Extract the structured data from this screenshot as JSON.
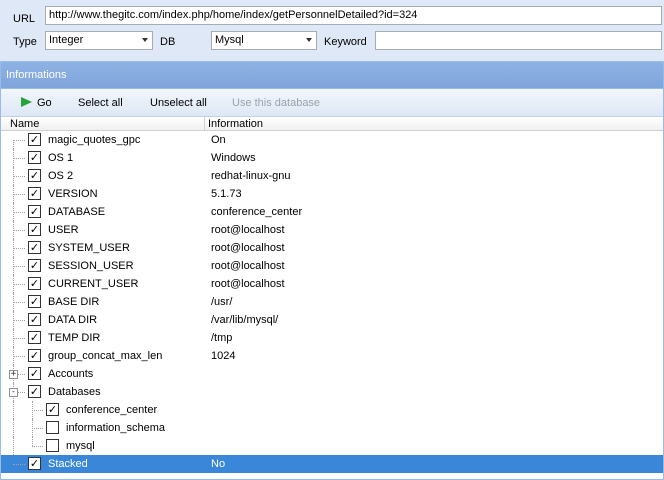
{
  "form": {
    "url_label": "URL",
    "url_value": "http://www.thegitc.com/index.php/home/index/getPersonnelDetailed?id=324",
    "type_label": "Type",
    "type_value": "Integer",
    "db_label": "DB",
    "db_value": "Mysql",
    "keyword_label": "Keyword",
    "keyword_value": ""
  },
  "panel": {
    "title": "Informations",
    "toolbar": {
      "go": "Go",
      "select_all": "Select all",
      "unselect_all": "Unselect all",
      "use_db": "Use this database"
    },
    "columns": {
      "name": "Name",
      "info": "Information"
    },
    "rows": [
      {
        "name": "magic_quotes_gpc",
        "info": "On",
        "checked": true
      },
      {
        "name": "OS 1",
        "info": "Windows",
        "checked": true
      },
      {
        "name": "OS 2",
        "info": "redhat-linux-gnu",
        "checked": true
      },
      {
        "name": "VERSION",
        "info": "5.1.73",
        "checked": true
      },
      {
        "name": "DATABASE",
        "info": "conference_center",
        "checked": true
      },
      {
        "name": "USER",
        "info": "root@localhost",
        "checked": true
      },
      {
        "name": "SYSTEM_USER",
        "info": "root@localhost",
        "checked": true
      },
      {
        "name": "SESSION_USER",
        "info": "root@localhost",
        "checked": true
      },
      {
        "name": "CURRENT_USER",
        "info": "root@localhost",
        "checked": true
      },
      {
        "name": "BASE DIR",
        "info": "/usr/",
        "checked": true
      },
      {
        "name": "DATA DIR",
        "info": "/var/lib/mysql/",
        "checked": true
      },
      {
        "name": "TEMP DIR",
        "info": "/tmp",
        "checked": true
      },
      {
        "name": "group_concat_max_len",
        "info": "1024",
        "checked": true
      },
      {
        "name": "Accounts",
        "info": "",
        "checked": true,
        "expander": "+"
      },
      {
        "name": "Databases",
        "info": "",
        "checked": true,
        "expander": "-"
      },
      {
        "name": "conference_center",
        "info": "",
        "checked": true
      },
      {
        "name": "information_schema",
        "info": "",
        "checked": false
      },
      {
        "name": "mysql",
        "info": "",
        "checked": false
      },
      {
        "name": "Stacked",
        "info": "No",
        "checked": true,
        "selected": true
      }
    ]
  },
  "colors": {
    "accent": "#3a86d8",
    "panel_header": "#86abdf",
    "go_icon": "#27a33b"
  }
}
